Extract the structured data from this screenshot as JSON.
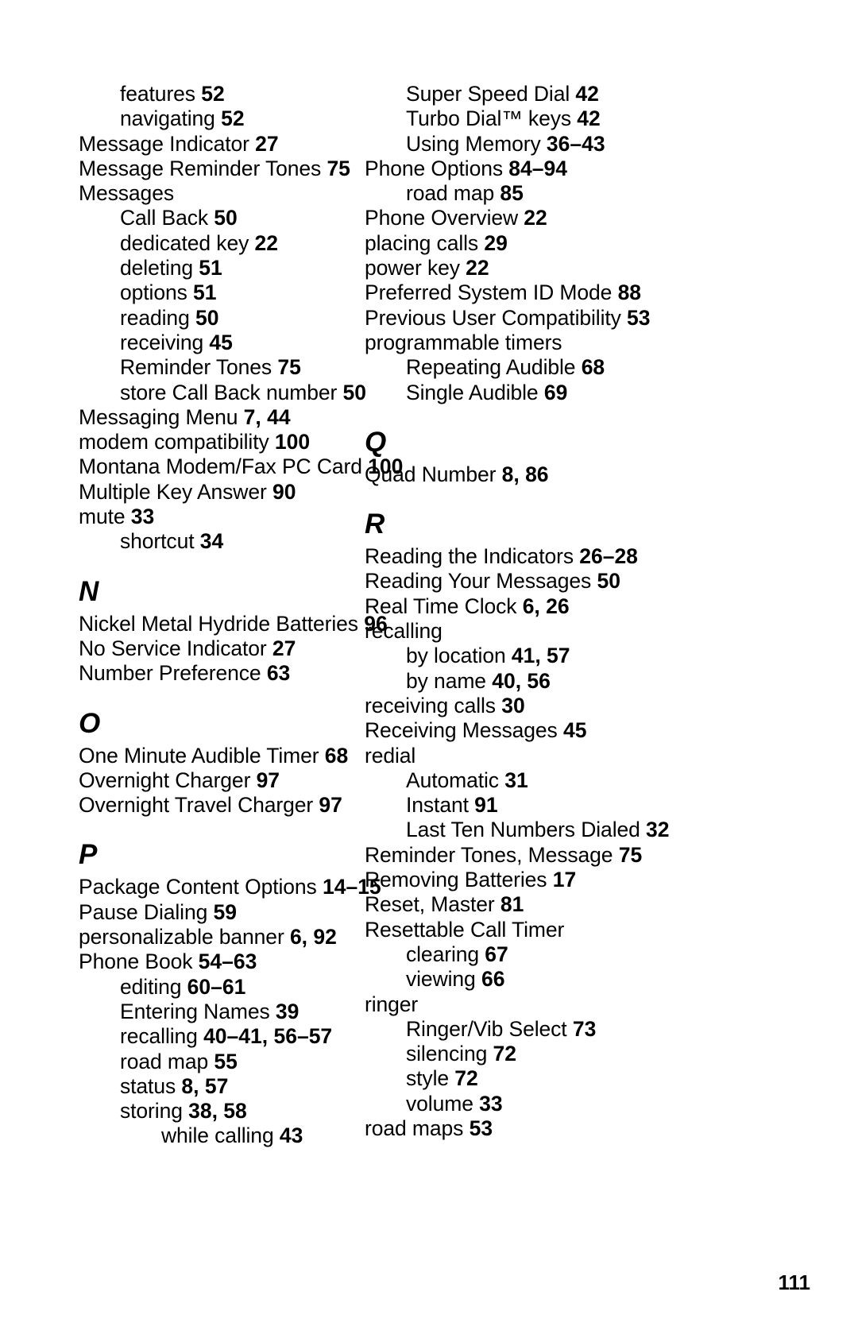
{
  "document": {
    "type": "index",
    "folio": "111"
  },
  "columns": [
    {
      "name": "left-column",
      "blocks": [
        {
          "kind": "entry",
          "level": 1,
          "label": "features",
          "pages": "52"
        },
        {
          "kind": "entry",
          "level": 1,
          "label": "navigating",
          "pages": "52"
        },
        {
          "kind": "entry",
          "level": 0,
          "label": "Message Indicator",
          "pages": "27"
        },
        {
          "kind": "entry",
          "level": 0,
          "label": "Message Reminder Tones",
          "pages": "75"
        },
        {
          "kind": "entry",
          "level": 0,
          "label": "Messages",
          "pages": ""
        },
        {
          "kind": "entry",
          "level": 1,
          "label": "Call Back",
          "pages": "50"
        },
        {
          "kind": "entry",
          "level": 1,
          "label": "dedicated key",
          "pages": "22"
        },
        {
          "kind": "entry",
          "level": 1,
          "label": "deleting",
          "pages": "51"
        },
        {
          "kind": "entry",
          "level": 1,
          "label": "options",
          "pages": "51"
        },
        {
          "kind": "entry",
          "level": 1,
          "label": "reading",
          "pages": "50"
        },
        {
          "kind": "entry",
          "level": 1,
          "label": "receiving",
          "pages": "45"
        },
        {
          "kind": "entry",
          "level": 1,
          "label": "Reminder Tones",
          "pages": "75"
        },
        {
          "kind": "entry",
          "level": 1,
          "label": "store Call Back number",
          "pages": "50"
        },
        {
          "kind": "entry",
          "level": 0,
          "label": "Messaging Menu",
          "pages": "7, 44"
        },
        {
          "kind": "entry",
          "level": 0,
          "label": "modem compatibility",
          "pages": "100"
        },
        {
          "kind": "entry",
          "level": 0,
          "label": "Montana Modem/Fax PC Card",
          "pages": "100"
        },
        {
          "kind": "entry",
          "level": 0,
          "label": "Multiple Key Answer",
          "pages": "90"
        },
        {
          "kind": "entry",
          "level": 0,
          "label": "mute",
          "pages": "33"
        },
        {
          "kind": "entry",
          "level": 1,
          "label": "shortcut",
          "pages": "34"
        },
        {
          "kind": "letter",
          "letter": "N"
        },
        {
          "kind": "entry",
          "level": 0,
          "label": "Nickel Metal Hydride Batteries",
          "pages": "96"
        },
        {
          "kind": "entry",
          "level": 0,
          "label": "No Service Indicator",
          "pages": "27"
        },
        {
          "kind": "entry",
          "level": 0,
          "label": "Number Preference",
          "pages": "63"
        },
        {
          "kind": "letter",
          "letter": "O"
        },
        {
          "kind": "entry",
          "level": 0,
          "label": "One Minute Audible Timer",
          "pages": "68"
        },
        {
          "kind": "entry",
          "level": 0,
          "label": "Overnight Charger",
          "pages": "97"
        },
        {
          "kind": "entry",
          "level": 0,
          "label": "Overnight Travel Charger",
          "pages": "97"
        },
        {
          "kind": "letter",
          "letter": "P"
        },
        {
          "kind": "entry",
          "level": 0,
          "label": "Package Content Options",
          "pages": "14–15"
        },
        {
          "kind": "entry",
          "level": 0,
          "label": "Pause Dialing",
          "pages": "59"
        },
        {
          "kind": "entry",
          "level": 0,
          "label": "personalizable banner",
          "pages": "6, 92"
        },
        {
          "kind": "entry",
          "level": 0,
          "label": "Phone Book",
          "pages": "54–63"
        },
        {
          "kind": "entry",
          "level": 1,
          "label": "editing",
          "pages": "60–61"
        },
        {
          "kind": "entry",
          "level": 1,
          "label": "Entering Names",
          "pages": "39"
        },
        {
          "kind": "entry",
          "level": 1,
          "label": "recalling",
          "pages": "40–41, 56–57"
        },
        {
          "kind": "entry",
          "level": 1,
          "label": "road map",
          "pages": "55"
        },
        {
          "kind": "entry",
          "level": 1,
          "label": "status",
          "pages": "8, 57"
        },
        {
          "kind": "entry",
          "level": 1,
          "label": "storing",
          "pages": "38, 58"
        },
        {
          "kind": "entry",
          "level": 2,
          "label": "while calling",
          "pages": "43"
        }
      ]
    },
    {
      "name": "right-column",
      "blocks": [
        {
          "kind": "entry",
          "level": 1,
          "label": "Super Speed Dial",
          "pages": "42"
        },
        {
          "kind": "entry",
          "level": 1,
          "label": "Turbo Dial™ keys",
          "pages": "42"
        },
        {
          "kind": "entry",
          "level": 1,
          "label": "Using Memory",
          "pages": "36–43"
        },
        {
          "kind": "entry",
          "level": 0,
          "label": "Phone Options",
          "pages": "84–94"
        },
        {
          "kind": "entry",
          "level": 1,
          "label": "road map",
          "pages": "85"
        },
        {
          "kind": "entry",
          "level": 0,
          "label": "Phone Overview",
          "pages": "22"
        },
        {
          "kind": "entry",
          "level": 0,
          "label": "placing calls",
          "pages": "29"
        },
        {
          "kind": "entry",
          "level": 0,
          "label": "power key",
          "pages": "22"
        },
        {
          "kind": "entry",
          "level": 0,
          "label": "Preferred System ID Mode",
          "pages": "88"
        },
        {
          "kind": "entry",
          "level": 0,
          "label": "Previous User Compatibility",
          "pages": "53"
        },
        {
          "kind": "entry",
          "level": 0,
          "label": "programmable timers",
          "pages": ""
        },
        {
          "kind": "entry",
          "level": 1,
          "label": "Repeating Audible",
          "pages": "68"
        },
        {
          "kind": "entry",
          "level": 1,
          "label": "Single Audible",
          "pages": "69"
        },
        {
          "kind": "letter",
          "letter": "Q"
        },
        {
          "kind": "entry",
          "level": 0,
          "label": "Quad Number",
          "pages": "8, 86"
        },
        {
          "kind": "letter",
          "letter": "R"
        },
        {
          "kind": "entry",
          "level": 0,
          "label": "Reading the Indicators",
          "pages": "26–28"
        },
        {
          "kind": "entry",
          "level": 0,
          "label": "Reading Your Messages",
          "pages": "50"
        },
        {
          "kind": "entry",
          "level": 0,
          "label": "Real Time Clock",
          "pages": "6, 26"
        },
        {
          "kind": "entry",
          "level": 0,
          "label": "recalling",
          "pages": ""
        },
        {
          "kind": "entry",
          "level": 1,
          "label": "by location",
          "pages": "41, 57"
        },
        {
          "kind": "entry",
          "level": 1,
          "label": "by name",
          "pages": "40, 56"
        },
        {
          "kind": "entry",
          "level": 0,
          "label": "receiving calls",
          "pages": "30"
        },
        {
          "kind": "entry",
          "level": 0,
          "label": "Receiving Messages",
          "pages": "45"
        },
        {
          "kind": "entry",
          "level": 0,
          "label": "redial",
          "pages": ""
        },
        {
          "kind": "entry",
          "level": 1,
          "label": "Automatic",
          "pages": "31"
        },
        {
          "kind": "entry",
          "level": 1,
          "label": "Instant",
          "pages": "91"
        },
        {
          "kind": "entry",
          "level": 1,
          "label": "Last Ten Numbers Dialed",
          "pages": "32"
        },
        {
          "kind": "entry",
          "level": 0,
          "label": "Reminder Tones, Message",
          "pages": "75"
        },
        {
          "kind": "entry",
          "level": 0,
          "label": "Removing Batteries",
          "pages": "17"
        },
        {
          "kind": "entry",
          "level": 0,
          "label": "Reset, Master",
          "pages": "81"
        },
        {
          "kind": "entry",
          "level": 0,
          "label": "Resettable Call Timer",
          "pages": ""
        },
        {
          "kind": "entry",
          "level": 1,
          "label": "clearing",
          "pages": "67"
        },
        {
          "kind": "entry",
          "level": 1,
          "label": "viewing",
          "pages": "66"
        },
        {
          "kind": "entry",
          "level": 0,
          "label": "ringer",
          "pages": ""
        },
        {
          "kind": "entry",
          "level": 1,
          "label": "Ringer/Vib Select",
          "pages": "73"
        },
        {
          "kind": "entry",
          "level": 1,
          "label": "silencing",
          "pages": "72"
        },
        {
          "kind": "entry",
          "level": 1,
          "label": "style",
          "pages": "72"
        },
        {
          "kind": "entry",
          "level": 1,
          "label": "volume",
          "pages": "33"
        },
        {
          "kind": "entry",
          "level": 0,
          "label": "road maps",
          "pages": "53"
        }
      ]
    }
  ]
}
